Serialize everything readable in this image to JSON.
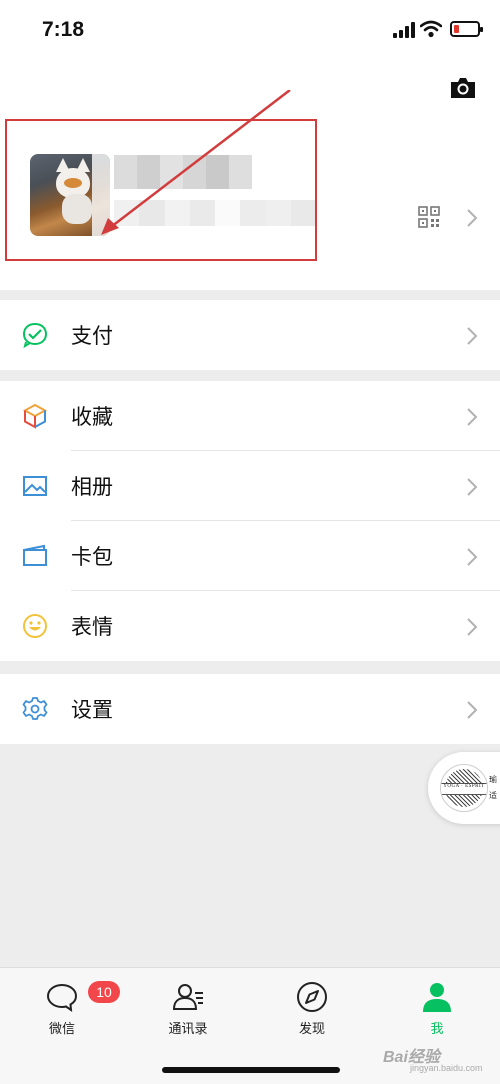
{
  "status_bar": {
    "time": "7:18"
  },
  "menu_sections": [
    {
      "items": [
        {
          "label": "支付",
          "icon": "pay-icon",
          "color": "#07c160"
        }
      ]
    },
    {
      "items": [
        {
          "label": "收藏",
          "icon": "favorites-cube-icon",
          "color": "#f0a23a"
        },
        {
          "label": "相册",
          "icon": "album-icon",
          "color": "#3d8fd6"
        },
        {
          "label": "卡包",
          "icon": "cards-wallet-icon",
          "color": "#3d8fd6"
        },
        {
          "label": "表情",
          "icon": "sticker-smile-icon",
          "color": "#f2c23a"
        }
      ]
    },
    {
      "items": [
        {
          "label": "设置",
          "icon": "settings-gear-icon",
          "color": "#3d8fd6"
        }
      ]
    }
  ],
  "floating_widget": {
    "logo_text": "YOGA · ESPRIT",
    "side_text": [
      "瑜",
      "适"
    ]
  },
  "tabbar": {
    "items": [
      {
        "label": "微信",
        "icon": "chat-bubble-icon",
        "badge": "10",
        "active": false
      },
      {
        "label": "通讯录",
        "icon": "contacts-icon",
        "active": false
      },
      {
        "label": "发现",
        "icon": "compass-icon",
        "active": false
      },
      {
        "label": "我",
        "icon": "me-person-icon",
        "active": true
      }
    ]
  },
  "watermark": {
    "text": "Bai经验",
    "sub": "jingyan.baidu.com"
  },
  "colors": {
    "accent": "#07c160",
    "badge": "#f2474a",
    "annotation": "#d23c3c"
  }
}
